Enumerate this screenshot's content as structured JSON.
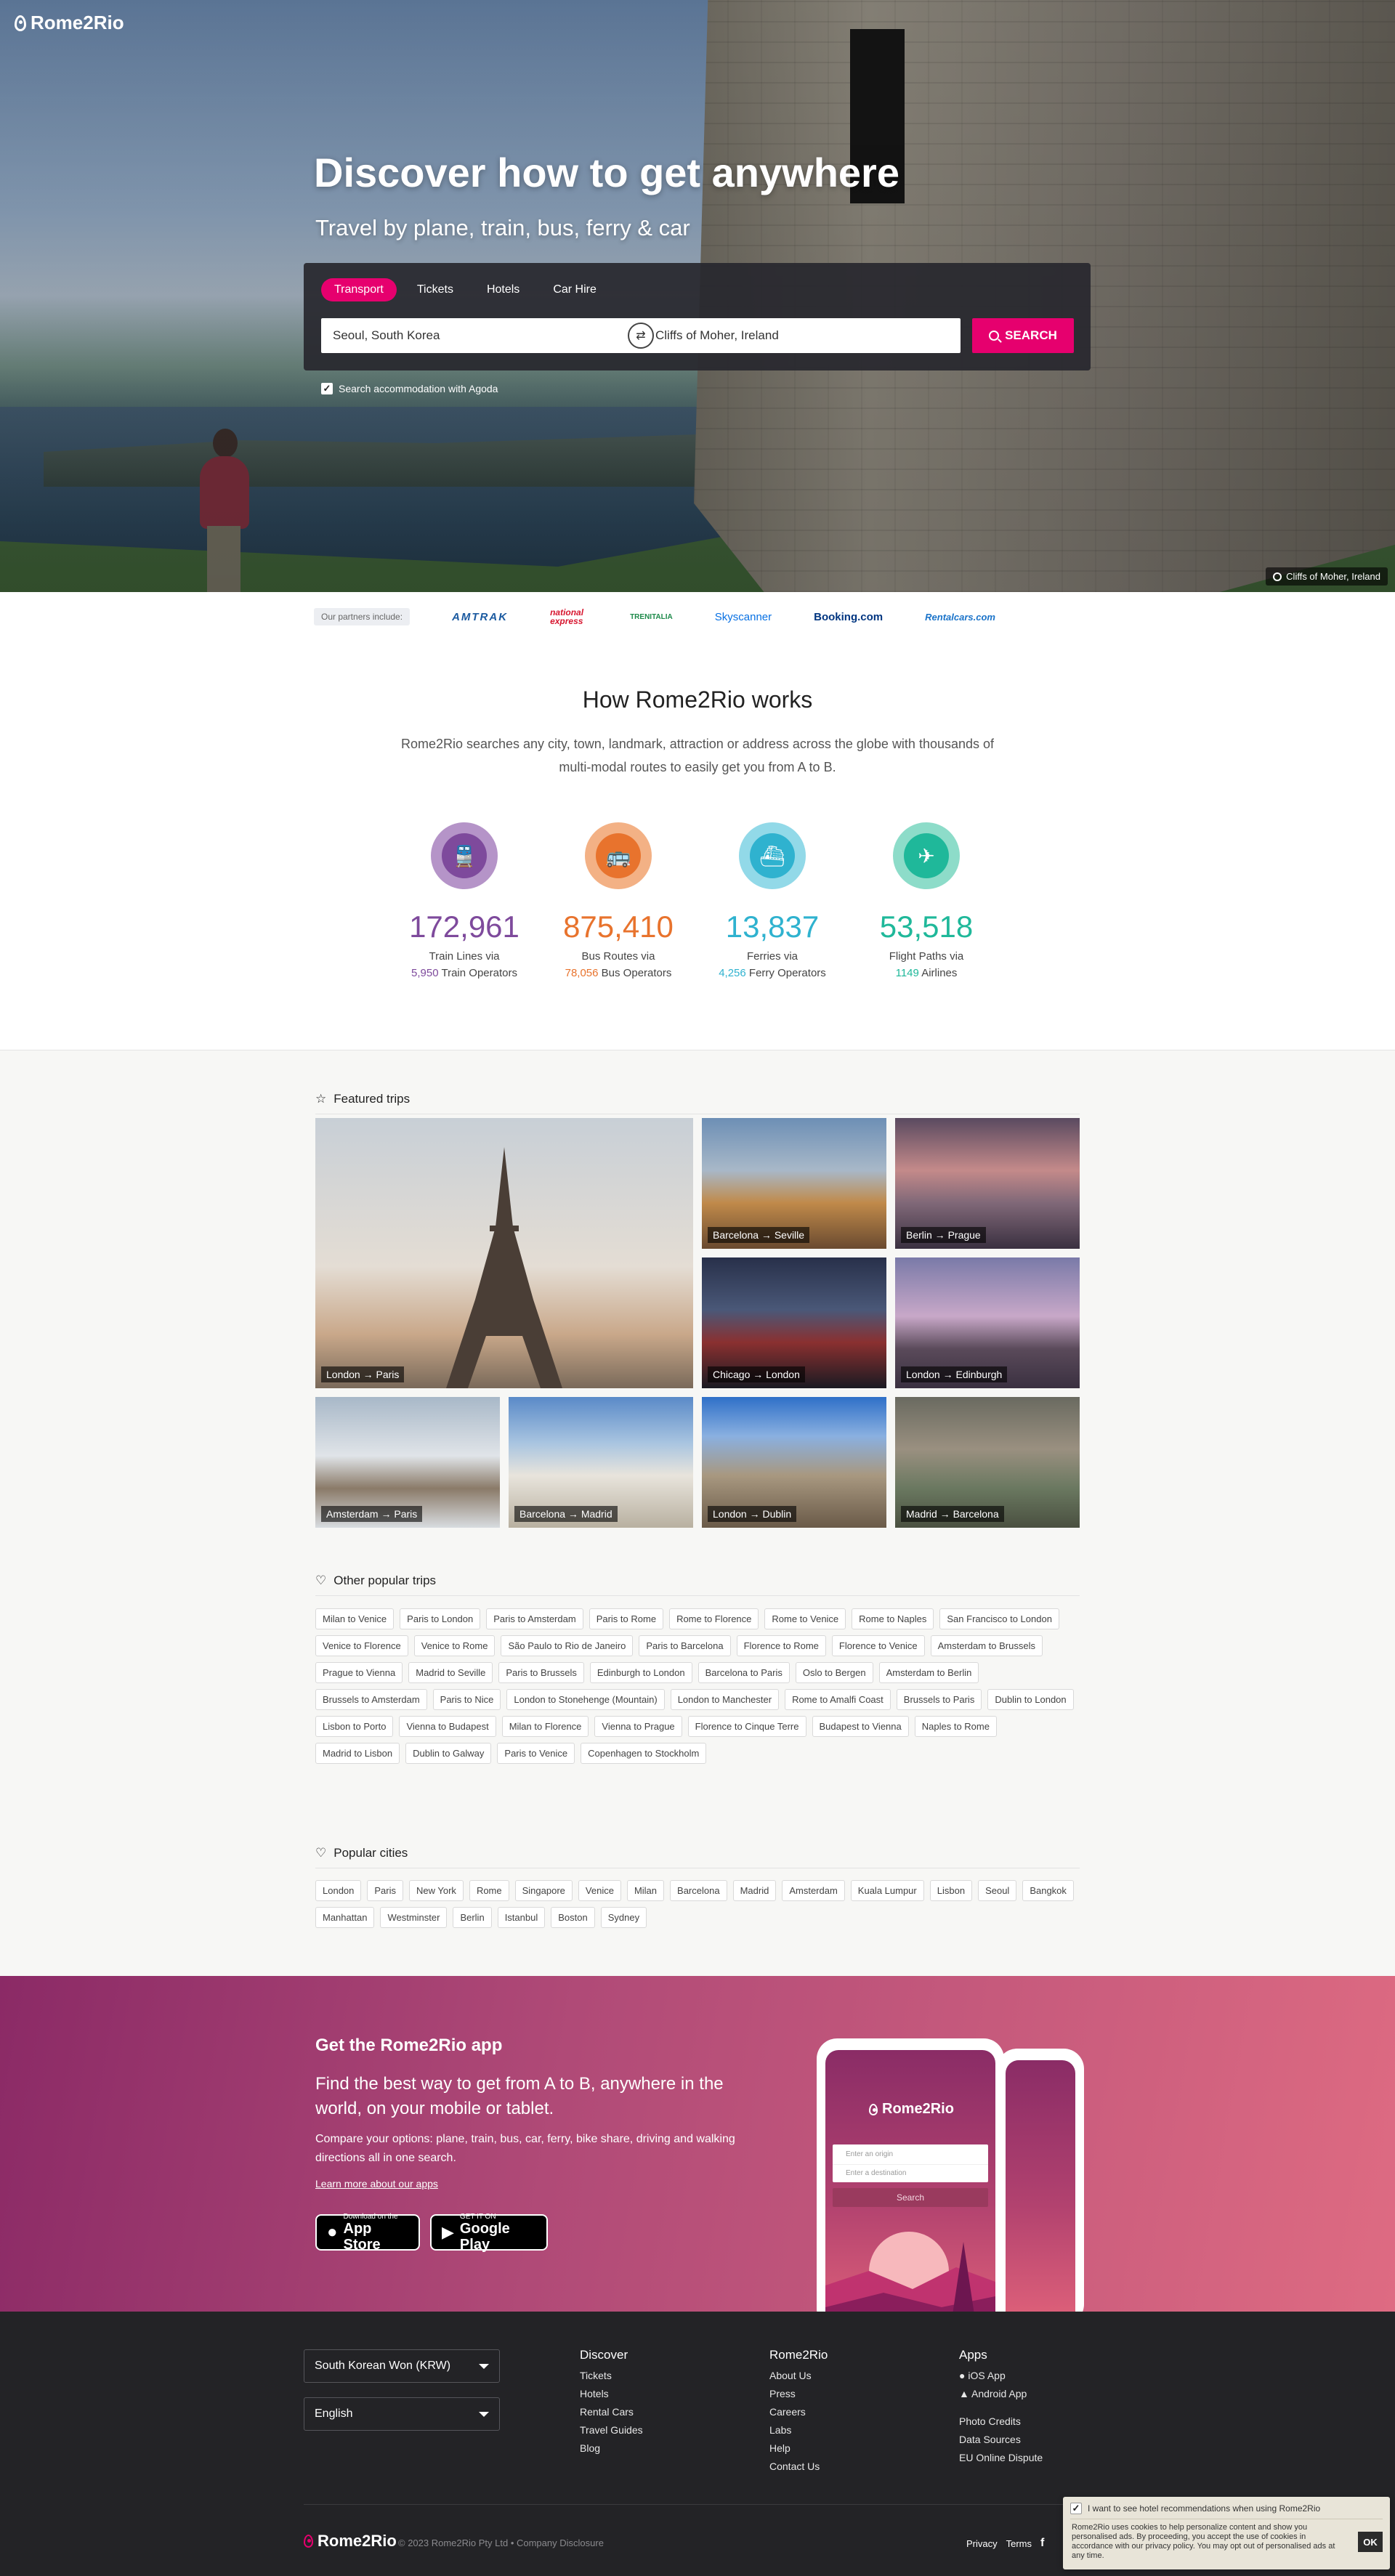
{
  "brand": {
    "name": "Rome2Rio",
    "accent": "#e6006e"
  },
  "hero": {
    "title": "Discover how to get anywhere",
    "subtitle": "Travel by plane, train, bus, ferry & car",
    "tabs": [
      "Transport",
      "Tickets",
      "Hotels",
      "Car Hire"
    ],
    "origin": "Seoul, South Korea",
    "destination": "Cliffs of Moher, Ireland",
    "search_label": "SEARCH",
    "agoda_label": "Search accommodation with Agoda",
    "agoda_checked": true,
    "photo_credit": "Cliffs of Moher, Ireland"
  },
  "partners": {
    "label": "Our partners include:",
    "items": [
      {
        "name": "AMTRAK",
        "color": "#1b5aa0"
      },
      {
        "name": "national express",
        "color": "#d7162f"
      },
      {
        "name": "TRENITALIA",
        "color": "#1d8a4a"
      },
      {
        "name": "Skyscanner",
        "color": "#0770e3"
      },
      {
        "name": "Booking.com",
        "color": "#003580"
      },
      {
        "name": "Rentalcars.com",
        "color": "#1a73c9"
      }
    ]
  },
  "how": {
    "title": "How Rome2Rio works",
    "description": "Rome2Rio searches any city, town, landmark, attraction or address across the globe with thousands of multi-modal routes to easily get you from A to B.",
    "stats": [
      {
        "icon": "train-icon",
        "glyph": "🚆",
        "value": "172,961",
        "label": "Train Lines via",
        "sub_value": "5,950",
        "sub_label": "Train Operators",
        "color": "#7e4a9c",
        "ring": "#b594c8"
      },
      {
        "icon": "bus-icon",
        "glyph": "🚌",
        "value": "875,410",
        "label": "Bus Routes via",
        "sub_value": "78,056",
        "sub_label": "Bus Operators",
        "color": "#e8732d",
        "ring": "#f3b185"
      },
      {
        "icon": "ferry-icon",
        "glyph": "⛴",
        "value": "13,837",
        "label": "Ferries via",
        "sub_value": "4,256",
        "sub_label": "Ferry Operators",
        "color": "#2fb2cf",
        "ring": "#92d9e8"
      },
      {
        "icon": "plane-icon",
        "glyph": "✈",
        "value": "53,518",
        "label": "Flight Paths via",
        "sub_value": "1149",
        "sub_label": "Airlines",
        "color": "#1fb89a",
        "ring": "#8ddcc9"
      }
    ]
  },
  "featured": {
    "title": "Featured trips",
    "trips": [
      {
        "label": "London → Paris",
        "bg": "linear-gradient(180deg,#c8cfd6 0%,#e4ddd4 55%,#c9a88a 80%,#7a6a5a 100%)"
      },
      {
        "label": "Barcelona → Seville",
        "bg": "linear-gradient(180deg,#6d8fb5 0%,#a8b8c8 40%,#c08a4a 65%,#6a4a30 100%)"
      },
      {
        "label": "Berlin → Prague",
        "bg": "linear-gradient(180deg,#5a4a60 0%,#c48a8a 40%,#806878 65%,#3a3040 100%)"
      },
      {
        "label": "Chicago → London",
        "bg": "linear-gradient(180deg,#28304a 0%,#4a5878 40%,#8a3030 65%,#1a1a22 100%)"
      },
      {
        "label": "London → Edinburgh",
        "bg": "linear-gradient(180deg,#7a7aa8 0%,#c8a8c8 45%,#5a4a5a 70%,#3a3040 100%)"
      },
      {
        "label": "Amsterdam → Paris",
        "bg": "linear-gradient(180deg,#a8b8c8 0%,#e0e4e8 45%,#8a7a68 70%,#d8dce0 100%)"
      },
      {
        "label": "Barcelona → Madrid",
        "bg": "linear-gradient(180deg,#5a8ac8 0%,#a8c4e0 35%,#e8e4dc 60%,#b8b0a0 100%)"
      },
      {
        "label": "London → Dublin",
        "bg": "linear-gradient(180deg,#2f70c8 0%,#8ab0e0 30%,#a89880 60%,#6a5a48 100%)"
      },
      {
        "label": "Madrid → Barcelona",
        "bg": "linear-gradient(180deg,#6a6a60 0%,#9a9080 40%,#6a7860 70%,#4a5040 100%)"
      }
    ]
  },
  "popular_trips": {
    "title": "Other popular trips",
    "items": [
      "Milan to Venice",
      "Paris to London",
      "Paris to Amsterdam",
      "Paris to Rome",
      "Rome to Florence",
      "Rome to Venice",
      "Rome to Naples",
      "San Francisco to London",
      "Venice to Florence",
      "Venice to Rome",
      "São Paulo to Rio de Janeiro",
      "Paris to Barcelona",
      "Florence to Rome",
      "Florence to Venice",
      "Amsterdam to Brussels",
      "Prague to Vienna",
      "Madrid to Seville",
      "Paris to Brussels",
      "Edinburgh to London",
      "Barcelona to Paris",
      "Oslo to Bergen",
      "Amsterdam to Berlin",
      "Brussels to Amsterdam",
      "Paris to Nice",
      "London to Stonehenge (Mountain)",
      "London to Manchester",
      "Rome to Amalfi Coast",
      "Brussels to Paris",
      "Dublin to London",
      "Lisbon to Porto",
      "Vienna to Budapest",
      "Milan to Florence",
      "Vienna to Prague",
      "Florence to Cinque Terre",
      "Budapest to Vienna",
      "Naples to Rome",
      "Madrid to Lisbon",
      "Dublin to Galway",
      "Paris to Venice",
      "Copenhagen to Stockholm"
    ]
  },
  "popular_cities": {
    "title": "Popular cities",
    "items": [
      "London",
      "Paris",
      "New York",
      "Rome",
      "Singapore",
      "Venice",
      "Milan",
      "Barcelona",
      "Madrid",
      "Amsterdam",
      "Kuala Lumpur",
      "Lisbon",
      "Seoul",
      "Bangkok",
      "Manhattan",
      "Westminster",
      "Berlin",
      "Istanbul",
      "Boston",
      "Sydney"
    ]
  },
  "app": {
    "title": "Get the Rome2Rio app",
    "lead": "Find the best way to get from A to B, anywhere in the world, on your mobile or tablet.",
    "description": "Compare your options: plane, train, bus, car, ferry, bike share, driving and walking directions all in one search.",
    "link": "Learn more about our apps",
    "appstore_small": "Download on the",
    "appstore_big": "App Store",
    "googleplay_small": "GET IT ON",
    "googleplay_big": "Google Play",
    "phone_origin_placeholder": "Enter an origin",
    "phone_dest_placeholder": "Enter a destination",
    "phone_search": "Search"
  },
  "footer": {
    "currency": "South Korean Won (KRW)",
    "language": "English",
    "columns": [
      {
        "title": "Discover",
        "links": [
          "Tickets",
          "Hotels",
          "Rental Cars",
          "Travel Guides",
          "Blog"
        ]
      },
      {
        "title": "Rome2Rio",
        "links": [
          "About Us",
          "Press",
          "Careers",
          "Labs",
          "Help",
          "Contact Us"
        ]
      },
      {
        "title": "Apps",
        "links": [
          "iOS App",
          "Android App"
        ],
        "extra": [
          "Photo Credits",
          "Data Sources",
          "EU Online Dispute"
        ]
      }
    ],
    "copyright": "© 2023 Rome2Rio Pty Ltd  •  Company Disclosure",
    "links": [
      "Privacy",
      "Terms"
    ]
  },
  "cookie": {
    "checkbox_label": "I want to see hotel recommendations when using Rome2Rio",
    "text": "Rome2Rio uses cookies to help personalize content and show you personalised ads. By proceeding, you accept the use of cookies in accordance with our privacy policy. You may opt out of personalised ads at any time.",
    "ok": "OK"
  }
}
